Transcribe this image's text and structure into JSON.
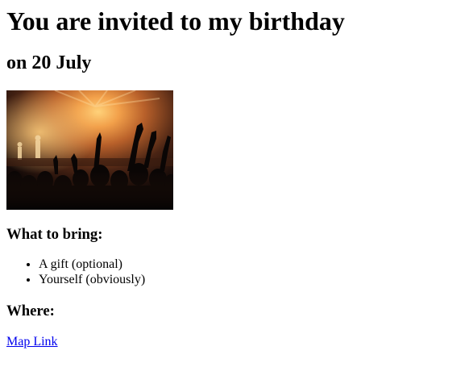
{
  "invite": {
    "title": "You are invited to my birthday",
    "date_line": "on 20 July"
  },
  "image": {
    "description_icon": "concert-crowd-photo"
  },
  "bring": {
    "heading": "What to bring:",
    "items": [
      {
        "label": "A gift (optional)"
      },
      {
        "label": "Yourself (obviously)"
      }
    ]
  },
  "where": {
    "heading": "Where:",
    "link_label": "Map Link",
    "link_color": "#0000ee"
  }
}
